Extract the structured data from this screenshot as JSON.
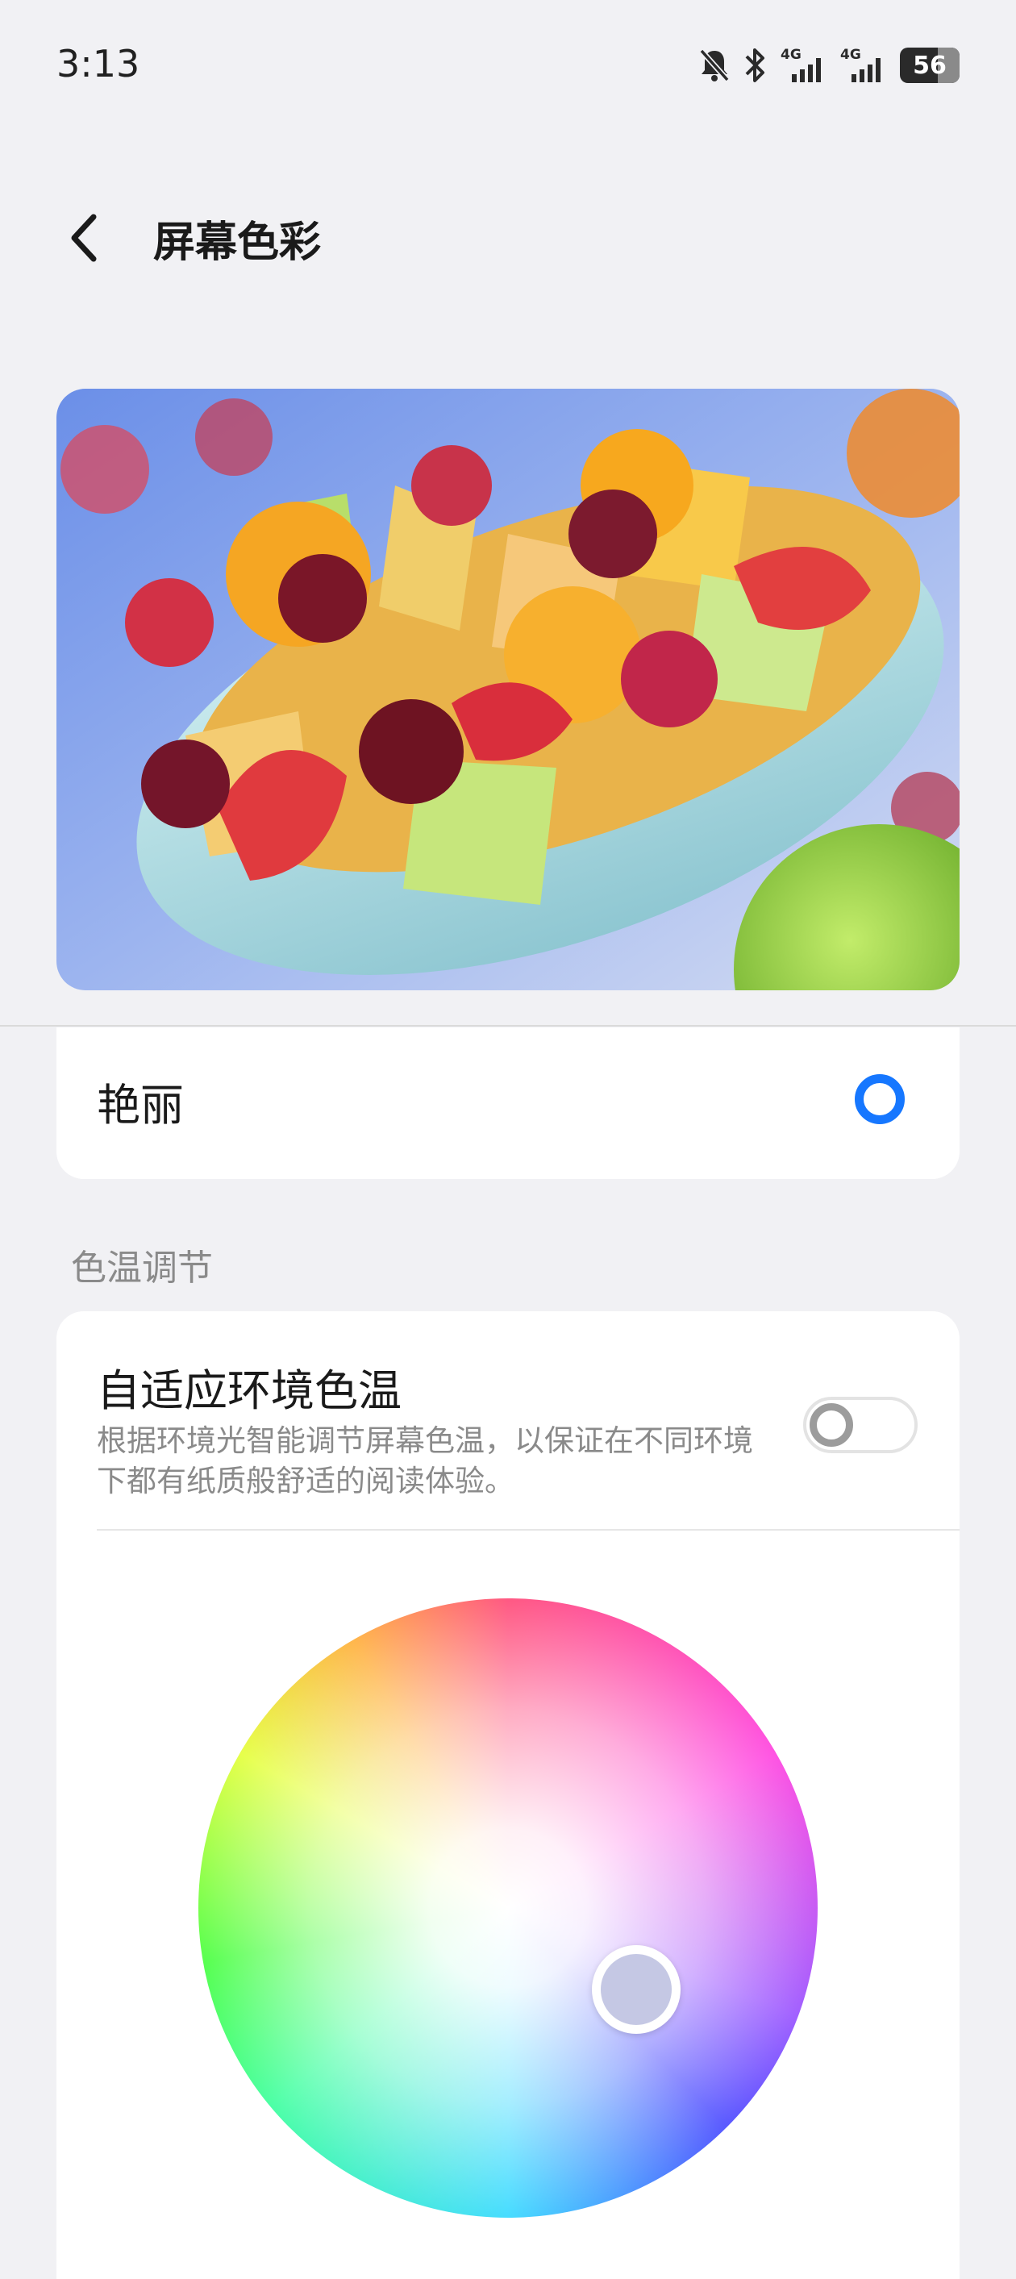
{
  "status_bar": {
    "time": "3:13",
    "battery": "56",
    "network_1": "4G",
    "network_2": "4G",
    "icons": [
      "bell-off-icon",
      "bluetooth-icon",
      "signal-4g-icon",
      "signal-4g-icon",
      "battery-icon"
    ]
  },
  "header": {
    "title": "屏幕色彩",
    "back_icon": "chevron-left-icon"
  },
  "preview": {
    "image": "fruit-salad-bowl"
  },
  "color_mode": {
    "option_label": "艳丽",
    "selected": true
  },
  "color_temperature": {
    "section_title": "色温调节",
    "adaptive_title": "自适应环境色温",
    "adaptive_desc": "根据环境光智能调节屏幕色温，以保证在不同环境下都有纸质般舒适的阅读体验。",
    "adaptive_enabled": false
  },
  "colors": {
    "accent": "#1677ff",
    "background": "#f1f1f4",
    "card": "#ffffff",
    "secondary_text": "#8a8a8a"
  }
}
